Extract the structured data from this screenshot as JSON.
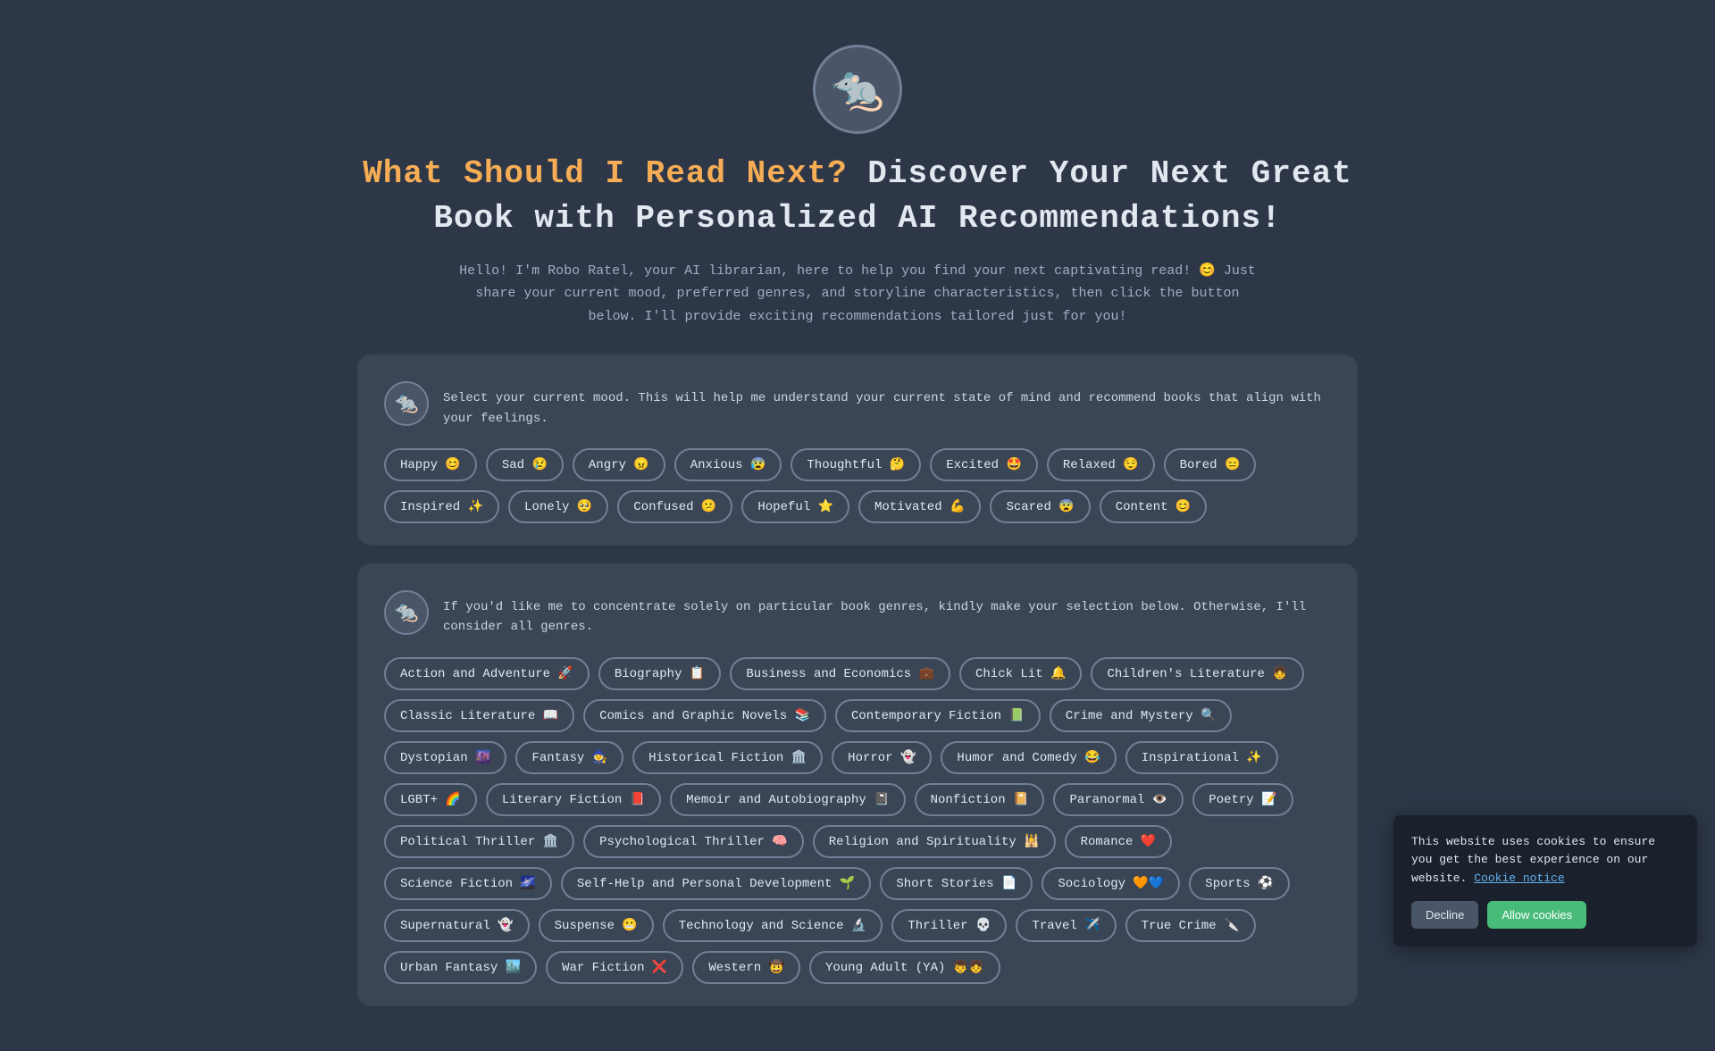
{
  "header": {
    "logo_emoji": "🐀",
    "title_part1": "What Should I Read Next?",
    "title_part2": " Discover Your Next Great Book with Personalized AI Recommendations!",
    "subtitle": "Hello! I'm Robo Ratel, your AI librarian, here to help you find your next captivating read! 😊 Just share your current mood, preferred genres, and storyline characteristics, then click the button below. I'll provide exciting recommendations tailored just for you!"
  },
  "mood_card": {
    "prompt": "Select your current mood. This will help me understand your current state of mind and recommend books that align with your feelings.",
    "moods": [
      {
        "label": "Happy",
        "emoji": "😊"
      },
      {
        "label": "Sad",
        "emoji": "😢"
      },
      {
        "label": "Angry",
        "emoji": "😠"
      },
      {
        "label": "Anxious",
        "emoji": "😰"
      },
      {
        "label": "Thoughtful",
        "emoji": "🤔"
      },
      {
        "label": "Excited",
        "emoji": "🤩"
      },
      {
        "label": "Relaxed",
        "emoji": "😌"
      },
      {
        "label": "Bored",
        "emoji": "😑"
      },
      {
        "label": "Inspired",
        "emoji": "✨"
      },
      {
        "label": "Lonely",
        "emoji": "🥺"
      },
      {
        "label": "Confused",
        "emoji": "😕"
      },
      {
        "label": "Hopeful",
        "emoji": "⭐"
      },
      {
        "label": "Motivated",
        "emoji": "💪"
      },
      {
        "label": "Scared",
        "emoji": "😨"
      },
      {
        "label": "Content",
        "emoji": "😊"
      }
    ]
  },
  "genre_card": {
    "prompt": "If you'd like me to concentrate solely on particular book genres, kindly make your selection below. Otherwise, I'll consider all genres.",
    "genres": [
      {
        "label": "Action and Adventure",
        "emoji": "🚀"
      },
      {
        "label": "Biography",
        "emoji": "📋"
      },
      {
        "label": "Business and Economics",
        "emoji": "💼"
      },
      {
        "label": "Chick Lit",
        "emoji": "🔔"
      },
      {
        "label": "Children's Literature",
        "emoji": "👧"
      },
      {
        "label": "Classic Literature",
        "emoji": "📖"
      },
      {
        "label": "Comics and Graphic Novels",
        "emoji": "📚"
      },
      {
        "label": "Contemporary Fiction",
        "emoji": "📗"
      },
      {
        "label": "Crime and Mystery",
        "emoji": "🔍"
      },
      {
        "label": "Dystopian",
        "emoji": "🌆"
      },
      {
        "label": "Fantasy",
        "emoji": "🧙"
      },
      {
        "label": "Historical Fiction",
        "emoji": "🏛️"
      },
      {
        "label": "Horror",
        "emoji": "👻"
      },
      {
        "label": "Humor and Comedy",
        "emoji": "😂"
      },
      {
        "label": "Inspirational",
        "emoji": "✨"
      },
      {
        "label": "LGBT+",
        "emoji": "🌈"
      },
      {
        "label": "Literary Fiction",
        "emoji": "📕"
      },
      {
        "label": "Memoir and Autobiography",
        "emoji": "📓"
      },
      {
        "label": "Nonfiction",
        "emoji": "📔"
      },
      {
        "label": "Paranormal",
        "emoji": "👁️"
      },
      {
        "label": "Poetry",
        "emoji": "📝"
      },
      {
        "label": "Political Thriller",
        "emoji": "🏛️"
      },
      {
        "label": "Psychological Thriller",
        "emoji": "🧠"
      },
      {
        "label": "Religion and Spirituality",
        "emoji": "🕌"
      },
      {
        "label": "Romance",
        "emoji": "❤️"
      },
      {
        "label": "Science Fiction",
        "emoji": "🌌"
      },
      {
        "label": "Self-Help and Personal Development",
        "emoji": "🌱"
      },
      {
        "label": "Short Stories",
        "emoji": "📄"
      },
      {
        "label": "Sociology",
        "emoji": "🧡💙"
      },
      {
        "label": "Sports",
        "emoji": "⚽"
      },
      {
        "label": "Supernatural",
        "emoji": "👻"
      },
      {
        "label": "Suspense",
        "emoji": "😬"
      },
      {
        "label": "Technology and Science",
        "emoji": "🔬"
      },
      {
        "label": "Thriller",
        "emoji": "💀"
      },
      {
        "label": "Travel",
        "emoji": "✈️"
      },
      {
        "label": "True Crime",
        "emoji": "🔪"
      },
      {
        "label": "Urban Fantasy",
        "emoji": "🏙️"
      },
      {
        "label": "War Fiction",
        "emoji": "❌"
      },
      {
        "label": "Western",
        "emoji": "🤠"
      },
      {
        "label": "Young Adult (YA)",
        "emoji": "👦👧"
      }
    ]
  },
  "cookie": {
    "text": "This website uses cookies to ensure you get the best experience on our website.",
    "link_text": "Cookie notice",
    "decline_label": "Decline",
    "allow_label": "Allow cookies"
  }
}
